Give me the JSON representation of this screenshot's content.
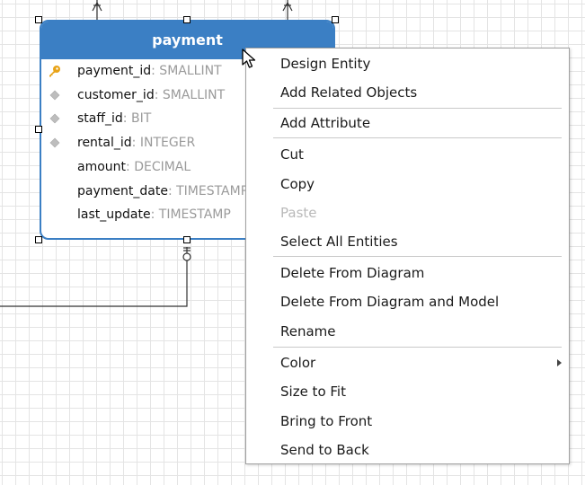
{
  "entity": {
    "name": "payment",
    "attributes": [
      {
        "name": "payment_id",
        "type": ": SMALLINT",
        "icon": "primary-key-icon"
      },
      {
        "name": "customer_id",
        "type": ": SMALLINT",
        "icon": "foreign-key-icon"
      },
      {
        "name": "staff_id",
        "type": ": BIT",
        "icon": "foreign-key-icon"
      },
      {
        "name": "rental_id",
        "type": ": INTEGER",
        "icon": "foreign-key-icon"
      },
      {
        "name": "amount",
        "type": ": DECIMAL",
        "icon": ""
      },
      {
        "name": "payment_date",
        "type": ": TIMESTAMP",
        "icon": ""
      },
      {
        "name": "last_update",
        "type": ": TIMESTAMP",
        "icon": ""
      }
    ]
  },
  "context_menu": {
    "items": [
      {
        "label": "Design Entity",
        "enabled": true
      },
      {
        "label": "Add Related Objects",
        "enabled": true
      },
      {
        "label": "Add Attribute",
        "enabled": true
      },
      {
        "label": "Cut",
        "enabled": true
      },
      {
        "label": "Copy",
        "enabled": true
      },
      {
        "label": "Paste",
        "enabled": false
      },
      {
        "label": "Select All Entities",
        "enabled": true
      },
      {
        "label": "Delete From Diagram",
        "enabled": true
      },
      {
        "label": "Delete From Diagram and Model",
        "enabled": true
      },
      {
        "label": "Rename",
        "enabled": true
      },
      {
        "label": "Color",
        "enabled": true,
        "submenu": true
      },
      {
        "label": "Size to Fit",
        "enabled": true
      },
      {
        "label": "Bring to Front",
        "enabled": true
      },
      {
        "label": "Send to Back",
        "enabled": true
      }
    ]
  },
  "colors": {
    "entity_header": "#3b7fc4",
    "primary_key_icon": "#e8a317",
    "foreign_key_icon": "#b5b5b5",
    "disabled_text": "#b9b9b9"
  }
}
